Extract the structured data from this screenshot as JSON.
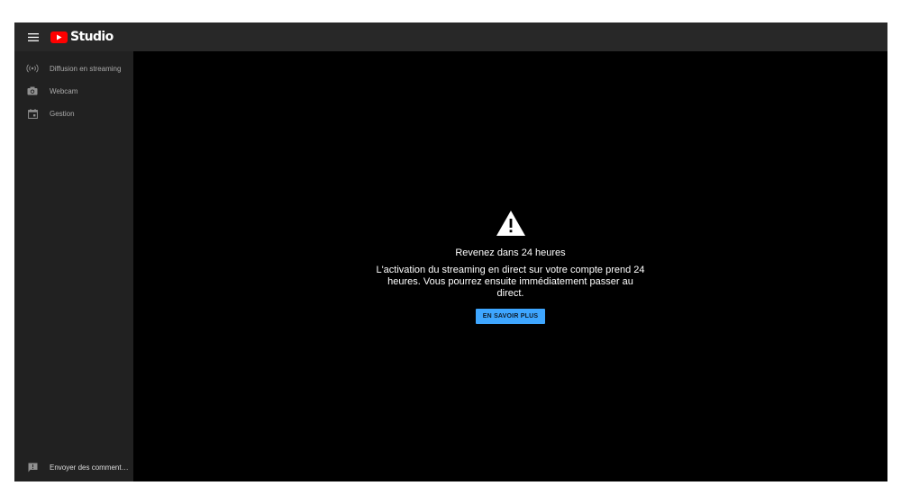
{
  "header": {
    "menu_icon": "hamburger-menu-icon",
    "logo_icon": "youtube-play-icon",
    "logo_text": "Studio"
  },
  "sidebar": {
    "items": [
      {
        "label": "Diffusion en streaming",
        "icon": "live-broadcast-icon"
      },
      {
        "label": "Webcam",
        "icon": "camera-icon"
      },
      {
        "label": "Gestion",
        "icon": "calendar-icon"
      }
    ],
    "feedback": {
      "label": "Envoyer des comment…",
      "icon": "feedback-icon"
    }
  },
  "main": {
    "icon": "warning-icon",
    "title": "Revenez dans 24 heures",
    "body": "L'activation du streaming en direct sur votre compte prend 24 heures. Vous pourrez ensuite immédiatement passer au direct.",
    "button_label": "EN SAVOIR PLUS"
  },
  "colors": {
    "header_bg": "#282828",
    "sidebar_bg": "#212121",
    "main_bg": "#000000",
    "brand_red": "#ff0000",
    "accent_blue": "#3ea6ff"
  }
}
